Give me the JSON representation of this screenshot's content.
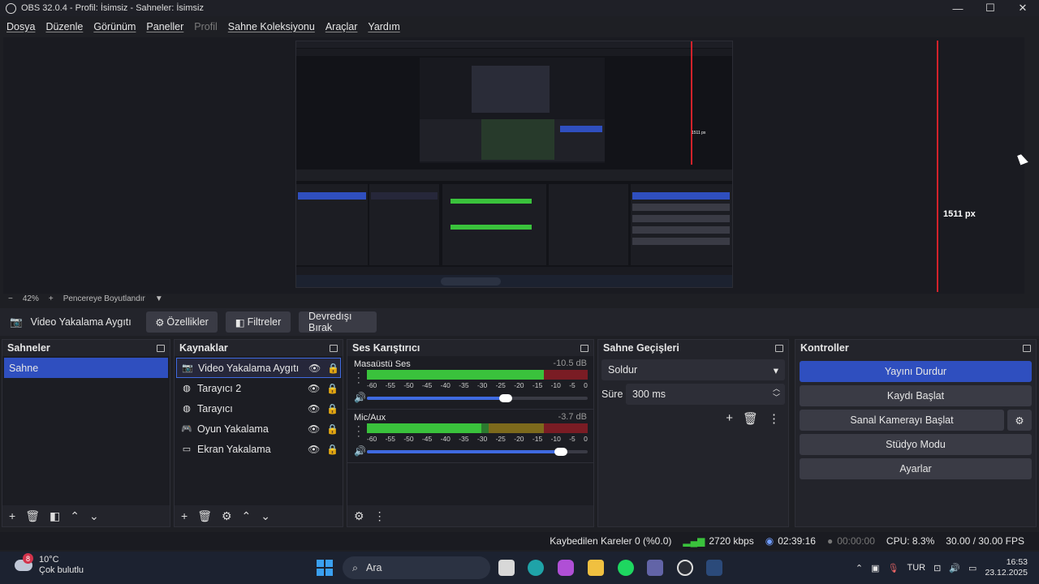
{
  "window": {
    "title": "OBS 32.0.4 - Profil: İsimsiz - Sahneler: İsimsiz"
  },
  "menu": [
    "Dosya",
    "Düzenle",
    "Görünüm",
    "Paneller",
    "Profil",
    "Sahne Koleksiyonu",
    "Araçlar",
    "Yardım"
  ],
  "preview": {
    "px_label": "1511 px"
  },
  "zoom": {
    "minus": "−",
    "value": "42%",
    "plus": "+",
    "mode": "Pencereye Boyutlandır"
  },
  "sourcebar": {
    "source_name": "Video Yakalama Aygıtı",
    "properties": "Özellikler",
    "filters": "Filtreler",
    "deactivate": "Devredışı Bırak"
  },
  "scenes": {
    "title": "Sahneler",
    "items": [
      "Sahne"
    ]
  },
  "sources": {
    "title": "Kaynaklar",
    "items": [
      "Video Yakalama Aygıtı",
      "Tarayıcı 2",
      "Tarayıcı",
      "Oyun Yakalama",
      "Ekran Yakalama"
    ]
  },
  "mixer": {
    "title": "Ses Karıştırıcı",
    "scale": [
      "-60",
      "-55",
      "-50",
      "-45",
      "-40",
      "-35",
      "-30",
      "-25",
      "-20",
      "-15",
      "-10",
      "-5",
      "0"
    ],
    "channels": [
      {
        "name": "Masaüstü Ses",
        "db": "-10.5 dB",
        "level": 0.8,
        "volume": 0.63
      },
      {
        "name": "Mic/Aux",
        "db": "-3.7 dB",
        "level": 0.52,
        "volume": 0.88
      }
    ]
  },
  "transitions": {
    "title": "Sahne Geçişleri",
    "type": "Soldur",
    "duration_label": "Süre",
    "duration": "300 ms"
  },
  "controls": {
    "title": "Kontroller",
    "stop_stream": "Yayını Durdur",
    "start_record": "Kaydı Başlat",
    "start_vcam": "Sanal Kamerayı Başlat",
    "studio_mode": "Stüdyo Modu",
    "settings": "Ayarlar"
  },
  "status": {
    "dropped": "Kaybedilen Kareler 0 (%0.0)",
    "bitrate": "2720 kbps",
    "stream_time": "02:39:16",
    "record_time": "00:00:00",
    "cpu": "CPU: 8.3%",
    "fps": "30.00 / 30.00 FPS"
  },
  "taskbar": {
    "temp": "10°C",
    "weather": "Çok bulutlu",
    "badge": "8",
    "search": "Ara",
    "lang": "TUR",
    "time": "16:53",
    "date": "23.12.2025"
  }
}
